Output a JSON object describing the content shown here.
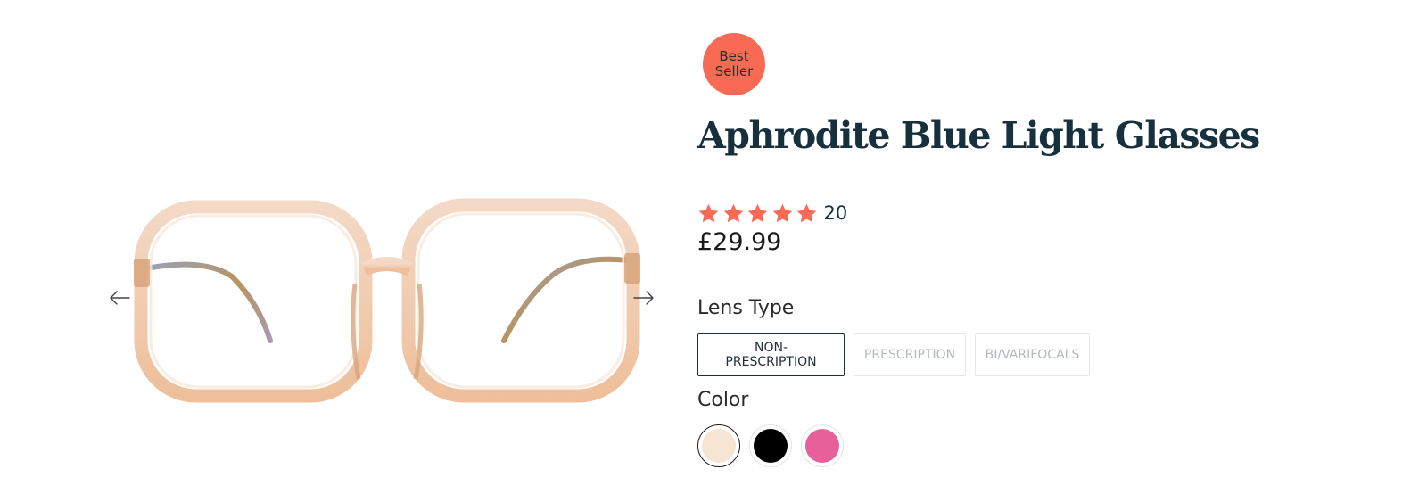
{
  "gallery": {
    "prev_icon": "arrow-left-icon",
    "next_icon": "arrow-right-icon",
    "image": "clear-peach-square-glasses-frame"
  },
  "product": {
    "badge": {
      "line1": "Best",
      "line2": "Seller",
      "color": "#f86a54"
    },
    "title": "Aphrodite Blue Light Glasses",
    "rating": {
      "stars": 5,
      "max_stars": 5,
      "star_color": "#f86a54",
      "count": "20"
    },
    "price": "£29.99"
  },
  "lens_type": {
    "label": "Lens Type",
    "options": [
      {
        "label": "NON-PRESCRIPTION",
        "selected": true
      },
      {
        "label": "PRESCRIPTION",
        "selected": false
      },
      {
        "label": "BI/VARIFOCALS",
        "selected": false
      }
    ]
  },
  "color": {
    "label": "Color",
    "swatches": [
      {
        "name": "peach",
        "hex": "#f7e5d3",
        "selected": true
      },
      {
        "name": "black",
        "hex": "#000000",
        "selected": false
      },
      {
        "name": "pink",
        "hex": "#e8609a",
        "selected": false
      }
    ]
  }
}
